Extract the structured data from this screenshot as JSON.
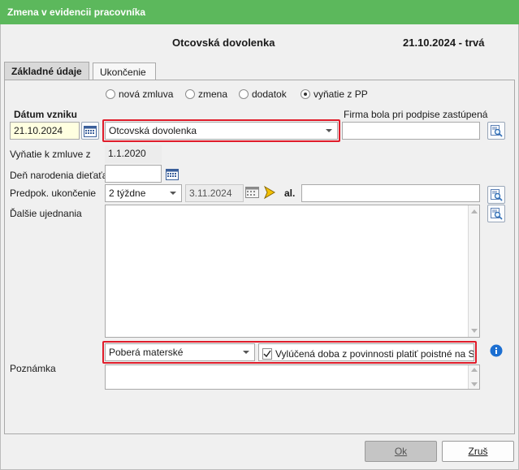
{
  "window": {
    "title": "Zmena v evidencii pracovníka"
  },
  "header": {
    "title": "Otcovská dovolenka",
    "date_status": "21.10.2024 - trvá"
  },
  "tabs": [
    {
      "label": "Základné údaje",
      "active": true
    },
    {
      "label": "Ukončenie",
      "active": false
    }
  ],
  "radio_options": [
    {
      "label": "nová zmluva",
      "selected": false
    },
    {
      "label": "zmena",
      "selected": false
    },
    {
      "label": "dodatok",
      "selected": false
    },
    {
      "label": "vyňatie z PP",
      "selected": true
    }
  ],
  "form": {
    "datum_vzniku_label": "Dátum vzniku",
    "datum_vzniku_value": "21.10.2024",
    "typ_value": "Otcovská dovolenka",
    "firma_label": "Firma bola pri podpise zastúpená",
    "firma_value": "",
    "vynatie_label": "Vyňatie k zmluve z",
    "vynatie_value": "1.1.2020",
    "den_narodenia_label": "Deň narodenia dieťaťa",
    "den_narodenia_value": "",
    "predpok_label": "Predpok. ukončenie",
    "predpok_select": "2 týždne",
    "predpok_date": "3.11.2024",
    "al_label": "al.",
    "al_value": "",
    "dalsie_label": "Ďalšie ujednania",
    "dalsie_value": "",
    "materske_select": "Poberá materské",
    "vylucena_label": "Vylúčená doba z povinnosti platiť poistné na SP",
    "vylucena_checked": true,
    "poznamka_label": "Poznámka",
    "poznamka_value": ""
  },
  "buttons": {
    "ok": "Ok",
    "cancel": "Zruš"
  },
  "colors": {
    "titlebar": "#5cb85c",
    "highlight_frame": "#e01c2a",
    "date_input_bg": "#ffffe0"
  },
  "icons": [
    "calendar-icon",
    "search-document-icon",
    "arrow-pointer-icon",
    "info-icon",
    "checkmark-icon"
  ]
}
